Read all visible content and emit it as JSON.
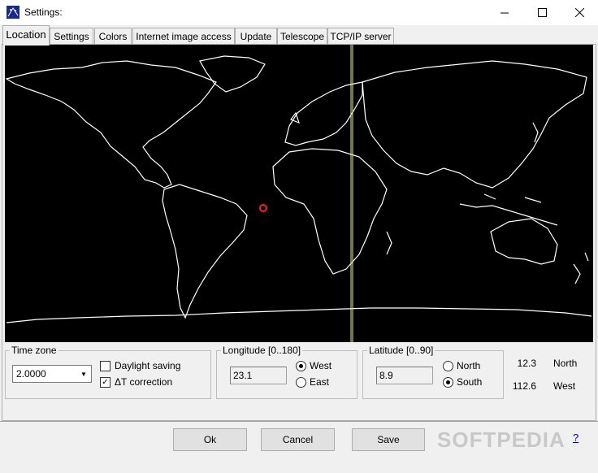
{
  "window": {
    "title": "Settings:"
  },
  "tabs": [
    {
      "label": "Location"
    },
    {
      "label": "Settings"
    },
    {
      "label": "Colors"
    },
    {
      "label": "Internet image access"
    },
    {
      "label": "Update"
    },
    {
      "label": "Telescope"
    },
    {
      "label": "TCP/IP server"
    }
  ],
  "map": {
    "marker_color": "#ff2020",
    "meridian_color": "#e8e8a0",
    "background": "#000000",
    "coast_color": "#ffffff"
  },
  "timezone": {
    "legend": "Time zone",
    "value": "2.0000",
    "daylight_label": "Daylight saving",
    "daylight_checked": false,
    "dt_label": "ΔT correction",
    "dt_checked": true
  },
  "longitude": {
    "legend": "Longitude [0..180]",
    "value": "23.1",
    "west_label": "West",
    "east_label": "East",
    "selected": "West"
  },
  "latitude": {
    "legend": "Latitude [0..90]",
    "value": "8.9",
    "north_label": "North",
    "south_label": "South",
    "selected": "South"
  },
  "readout": {
    "value1": "12.3",
    "dir1": "North",
    "value2": "112.6",
    "dir2": "West"
  },
  "buttons": {
    "ok": "Ok",
    "cancel": "Cancel",
    "save": "Save",
    "help": "?"
  },
  "watermark": "SOFTPEDIA"
}
